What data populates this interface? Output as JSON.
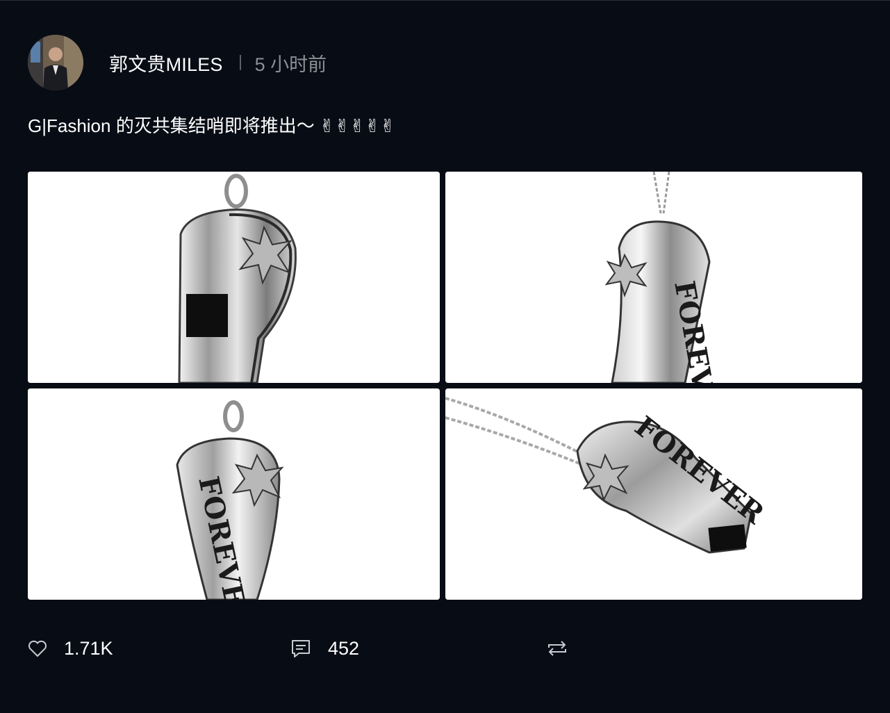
{
  "author": {
    "name": "郭文贵MILES",
    "separator": "|",
    "time": "5 小时前"
  },
  "post": {
    "text": "G|Fashion 的灭共集结哨即将推出～ ✌✌✌✌✌"
  },
  "photos": [
    {
      "icon": "whistle-photo",
      "engraving": ""
    },
    {
      "icon": "whistle-photo",
      "engraving": "FOREVER"
    },
    {
      "icon": "whistle-photo",
      "engraving": "FOREVER"
    },
    {
      "icon": "whistle-photo",
      "engraving": "FOREVER"
    }
  ],
  "actions": {
    "like": {
      "icon": "heart-icon",
      "count": "1.71K"
    },
    "comment": {
      "icon": "comment-icon",
      "count": "452"
    },
    "repost": {
      "icon": "repost-icon",
      "count": ""
    }
  },
  "colors": {
    "background": "#080c15",
    "text": "#ffffff",
    "muted": "#8b8f96"
  }
}
